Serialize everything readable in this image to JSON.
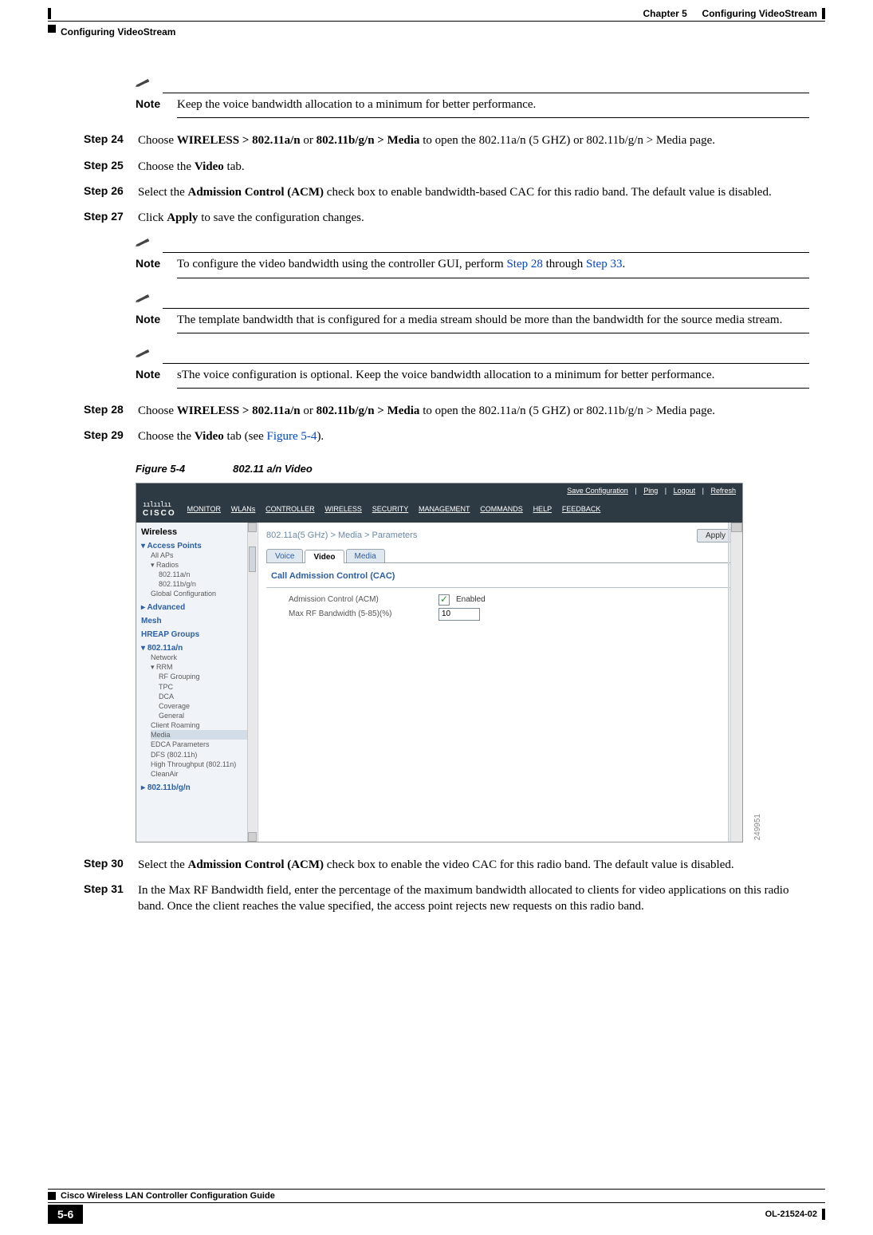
{
  "header": {
    "chapter": "Chapter 5",
    "chapter_title": "Configuring VideoStream",
    "section": "Configuring VideoStream"
  },
  "notes": {
    "note_label": "Note",
    "n1": "Keep the voice bandwidth allocation to a minimum for better performance.",
    "n2_pre": "To configure the video bandwidth using the controller GUI, perform ",
    "n2_link1": "Step 28",
    "n2_mid": " through ",
    "n2_link2": "Step 33",
    "n2_post": ".",
    "n3": "The template bandwidth that is configured for a media stream should be more than the bandwidth for the source media stream.",
    "n4": "sThe voice configuration is optional. Keep the voice bandwidth allocation to a minimum for better performance."
  },
  "steps": {
    "s24": {
      "label": "Step 24",
      "t1": "Choose ",
      "b1": "WIRELESS > 802.11a/n",
      "t2": " or ",
      "b2": "802.11b/g/n > Media",
      "t3": " to open the 802.11a/n (5 GHZ) or 802.11b/g/n > Media page."
    },
    "s25": {
      "label": "Step 25",
      "t1": "Choose the ",
      "b1": "Video",
      "t2": " tab."
    },
    "s26": {
      "label": "Step 26",
      "t1": "Select the ",
      "b1": "Admission Control (ACM)",
      "t2": " check box to enable bandwidth-based CAC for this radio band. The default value is disabled."
    },
    "s27": {
      "label": "Step 27",
      "t1": "Click ",
      "b1": "Apply",
      "t2": " to save the configuration changes."
    },
    "s28": {
      "label": "Step 28",
      "t1": "Choose ",
      "b1": "WIRELESS > 802.11a/n",
      "t2": " or ",
      "b2": "802.11b/g/n > Media",
      "t3": " to open the 802.11a/n (5 GHZ) or 802.11b/g/n > Media page."
    },
    "s29": {
      "label": "Step 29",
      "t1": "Choose the ",
      "b1": "Video",
      "t2": " tab (see ",
      "link": "Figure 5-4",
      "t3": ")."
    },
    "s30": {
      "label": "Step 30",
      "t1": "Select the ",
      "b1": "Admission Control (ACM)",
      "t2": " check box to enable the video CAC for this radio band. The default value is disabled."
    },
    "s31": {
      "label": "Step 31",
      "t1": "In the Max RF Bandwidth field, enter the percentage of the maximum bandwidth allocated to clients for video applications on this radio band. Once the client reaches the value specified, the access point rejects new requests on this radio band."
    }
  },
  "figure": {
    "label": "Figure 5-4",
    "title": "802.11 a/n Video",
    "side_num": "249951"
  },
  "screenshot": {
    "top_links": {
      "save": "Save Configuration",
      "ping": "Ping",
      "logout": "Logout",
      "refresh": "Refresh"
    },
    "brand_bars": "ıılıılıı",
    "brand": "CISCO",
    "nav": {
      "monitor": "MONITOR",
      "wlans": "WLANs",
      "controller": "CONTROLLER",
      "wireless": "WIRELESS",
      "security": "SECURITY",
      "mgmt": "MANAGEMENT",
      "cmds": "COMMANDS",
      "help": "HELP",
      "feedback": "FEEDBACK"
    },
    "left": {
      "title": "Wireless",
      "ap_grp": "Access Points",
      "all_aps": "All APs",
      "radios": "Radios",
      "r80211an": "802.11a/n",
      "r80211bgn": "802.11b/g/n",
      "globalcfg": "Global Configuration",
      "advanced": "Advanced",
      "mesh": "Mesh",
      "hreap": "HREAP Groups",
      "grp80211an": "802.11a/n",
      "network": "Network",
      "rrm": "RRM",
      "rfg": "RF Grouping",
      "tpc": "TPC",
      "dca": "DCA",
      "coverage": "Coverage",
      "general": "General",
      "roaming": "Client Roaming",
      "media": "Media",
      "edca": "EDCA Parameters",
      "dfs": "DFS (802.11h)",
      "ht": "High Throughput (802.11n)",
      "cleanair": "CleanAir",
      "grp80211bgn": "802.11b/g/n"
    },
    "main": {
      "crumb": "802.11a(5 GHz) > Media > Parameters",
      "apply": "Apply",
      "tab_voice": "Voice",
      "tab_video": "Video",
      "tab_media": "Media",
      "section": "Call Admission Control (CAC)",
      "acm_lbl": "Admission Control (ACM)",
      "acm_enabled": "Enabled",
      "maxrf_lbl": "Max RF Bandwidth (5-85)(%)",
      "maxrf_val": "10"
    }
  },
  "footer": {
    "guide": "Cisco Wireless LAN Controller Configuration Guide",
    "pagenum": "5-6",
    "docid": "OL-21524-02"
  }
}
